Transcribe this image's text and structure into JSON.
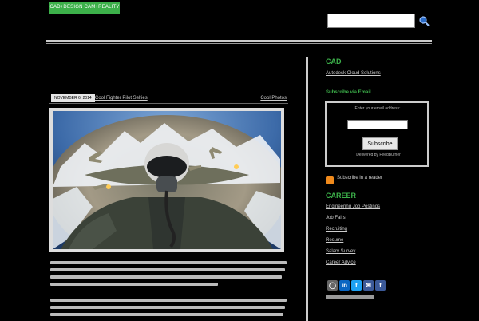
{
  "header": {
    "site_badge": "CAD+DESIGN CAM+REALITY",
    "search_placeholder": ""
  },
  "post": {
    "date": "NOVEMBER 6, 2014",
    "title": "Cool Fighter Pilot Selfies",
    "category": "Cool Photos"
  },
  "sidebar": {
    "section1_title": "CAD",
    "section1_link": "Autodesk Cloud Solutions",
    "subscribe_title": "Subscribe via Email",
    "subscribe_text": "Enter your email address:",
    "subscribe_button": "Subscribe",
    "subscribe_footer": "Delivered by FeedBurner",
    "rss_link": "Subscribe in a reader",
    "section2_title": "CAREER",
    "career_links": [
      "Engineering Job Postings",
      "Job Fairs",
      "Recruiting",
      "Resume",
      "Salary Survey",
      "Career Advice"
    ]
  },
  "social": {
    "icons": [
      "instagram-icon",
      "linkedin-icon",
      "twitter-icon",
      "email-icon",
      "facebook-icon"
    ],
    "colors": [
      "#666666",
      "#0a66c2",
      "#1da1f2",
      "#3b5998",
      "#3b5998"
    ]
  },
  "colors": {
    "accent": "#3cb04a",
    "background": "#000000"
  }
}
